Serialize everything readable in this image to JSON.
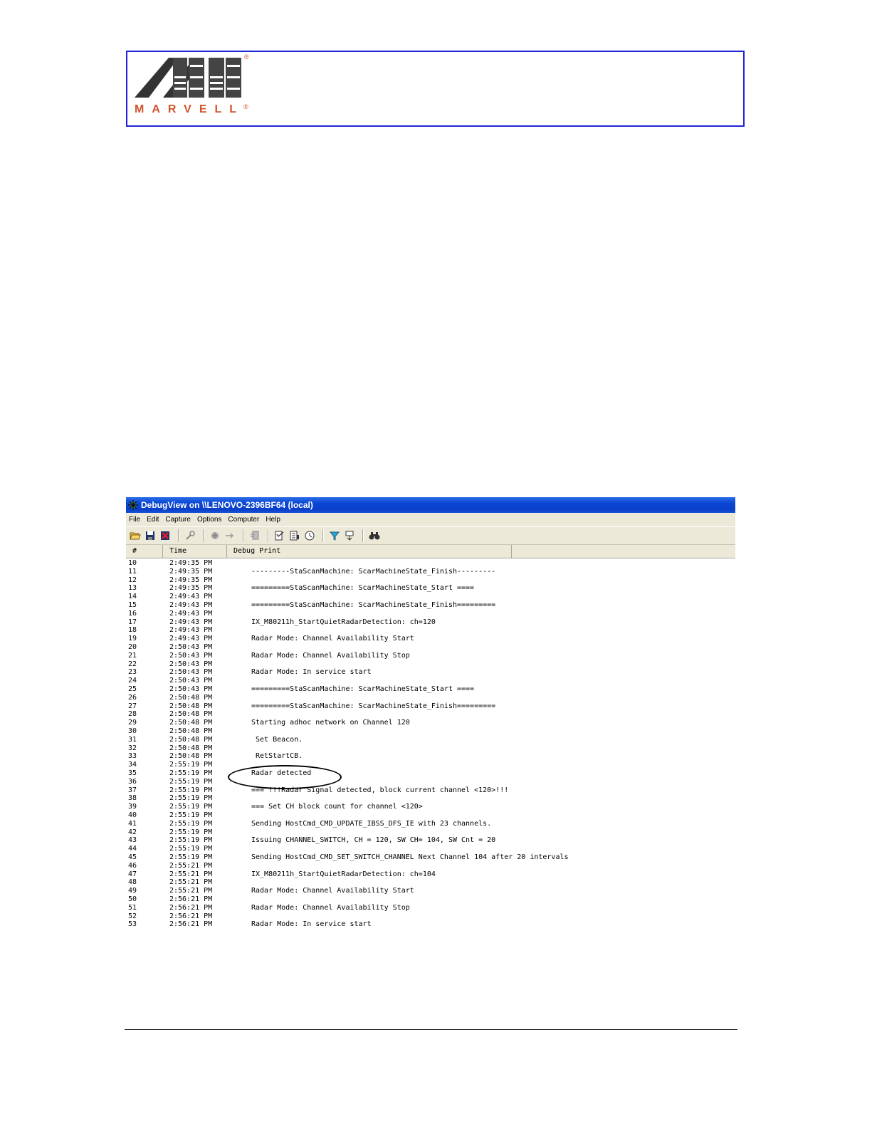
{
  "logo": {
    "text": "MARVELL",
    "registered": "®"
  },
  "window": {
    "title": "DebugView on \\\\LENOVO-2396BF64 (local)",
    "menu": [
      "File",
      "Edit",
      "Capture",
      "Options",
      "Computer",
      "Help"
    ],
    "toolbar_icons": [
      "open-icon",
      "save-icon",
      "clear-icon",
      "capture-icon",
      "autoscroll-icon",
      "forward-icon",
      "log-icon",
      "timestamp-icon",
      "copy-icon",
      "clock-icon",
      "filter-icon",
      "highlight-icon",
      "find-icon"
    ],
    "columns": [
      "#",
      "Time",
      "Debug Print"
    ],
    "rows": [
      {
        "n": "10",
        "time": "2:49:35 PM",
        "msg": ""
      },
      {
        "n": "11",
        "time": "2:49:35 PM",
        "msg": "---------StaScanMachine: ScarMachineState_Finish---------"
      },
      {
        "n": "12",
        "time": "2:49:35 PM",
        "msg": ""
      },
      {
        "n": "13",
        "time": "2:49:35 PM",
        "msg": "=========StaScanMachine: ScarMachineState_Start ===="
      },
      {
        "n": "14",
        "time": "2:49:43 PM",
        "msg": ""
      },
      {
        "n": "15",
        "time": "2:49:43 PM",
        "msg": "=========StaScanMachine: ScarMachineState_Finish========="
      },
      {
        "n": "16",
        "time": "2:49:43 PM",
        "msg": ""
      },
      {
        "n": "17",
        "time": "2:49:43 PM",
        "msg": "IX_M80211h_StartQuietRadarDetection: ch=120"
      },
      {
        "n": "18",
        "time": "2:49:43 PM",
        "msg": ""
      },
      {
        "n": "19",
        "time": "2:49:43 PM",
        "msg": "Radar Mode: Channel Availability Start"
      },
      {
        "n": "20",
        "time": "2:50:43 PM",
        "msg": ""
      },
      {
        "n": "21",
        "time": "2:50:43 PM",
        "msg": "Radar Mode: Channel Availability Stop"
      },
      {
        "n": "22",
        "time": "2:50:43 PM",
        "msg": ""
      },
      {
        "n": "23",
        "time": "2:50:43 PM",
        "msg": "Radar Mode: In service start"
      },
      {
        "n": "24",
        "time": "2:50:43 PM",
        "msg": ""
      },
      {
        "n": "25",
        "time": "2:50:43 PM",
        "msg": "=========StaScanMachine: ScarMachineState_Start ===="
      },
      {
        "n": "26",
        "time": "2:50:48 PM",
        "msg": ""
      },
      {
        "n": "27",
        "time": "2:50:48 PM",
        "msg": "=========StaScanMachine: ScarMachineState_Finish========="
      },
      {
        "n": "28",
        "time": "2:50:48 PM",
        "msg": ""
      },
      {
        "n": "29",
        "time": "2:50:48 PM",
        "msg": "Starting adhoc network on Channel 120"
      },
      {
        "n": "30",
        "time": "2:50:48 PM",
        "msg": ""
      },
      {
        "n": "31",
        "time": "2:50:48 PM",
        "msg": " Set Beacon."
      },
      {
        "n": "32",
        "time": "2:50:48 PM",
        "msg": ""
      },
      {
        "n": "33",
        "time": "2:50:48 PM",
        "msg": " RetStartCB."
      },
      {
        "n": "34",
        "time": "2:55:19 PM",
        "msg": ""
      },
      {
        "n": "35",
        "time": "2:55:19 PM",
        "msg": "Radar detected"
      },
      {
        "n": "36",
        "time": "2:55:19 PM",
        "msg": ""
      },
      {
        "n": "37",
        "time": "2:55:19 PM",
        "msg": "=== !!!Radar Signal detected, block current channel <120>!!!"
      },
      {
        "n": "38",
        "time": "2:55:19 PM",
        "msg": ""
      },
      {
        "n": "39",
        "time": "2:55:19 PM",
        "msg": "=== Set CH block count for channel <120>"
      },
      {
        "n": "40",
        "time": "2:55:19 PM",
        "msg": ""
      },
      {
        "n": "41",
        "time": "2:55:19 PM",
        "msg": "Sending HostCmd_CMD_UPDATE_IBSS_DFS_IE with 23 channels."
      },
      {
        "n": "42",
        "time": "2:55:19 PM",
        "msg": ""
      },
      {
        "n": "43",
        "time": "2:55:19 PM",
        "msg": "Issuing CHANNEL_SWITCH, CH = 120, SW CH= 104, SW Cnt = 20"
      },
      {
        "n": "44",
        "time": "2:55:19 PM",
        "msg": ""
      },
      {
        "n": "45",
        "time": "2:55:19 PM",
        "msg": "Sending HostCmd_CMD_SET_SWITCH_CHANNEL Next Channel 104 after 20 intervals"
      },
      {
        "n": "46",
        "time": "2:55:21 PM",
        "msg": ""
      },
      {
        "n": "47",
        "time": "2:55:21 PM",
        "msg": "IX_M80211h_StartQuietRadarDetection: ch=104"
      },
      {
        "n": "48",
        "time": "2:55:21 PM",
        "msg": ""
      },
      {
        "n": "49",
        "time": "2:55:21 PM",
        "msg": "Radar Mode: Channel Availability Start"
      },
      {
        "n": "50",
        "time": "2:56:21 PM",
        "msg": ""
      },
      {
        "n": "51",
        "time": "2:56:21 PM",
        "msg": "Radar Mode: Channel Availability Stop"
      },
      {
        "n": "52",
        "time": "2:56:21 PM",
        "msg": ""
      },
      {
        "n": "53",
        "time": "2:56:21 PM",
        "msg": "Radar Mode: In service start"
      }
    ]
  },
  "colors": {
    "logo_border": "#1f24d6",
    "logo_text": "#d0542c",
    "titlebar": "#0a46d3",
    "chrome": "#ece9d8"
  }
}
